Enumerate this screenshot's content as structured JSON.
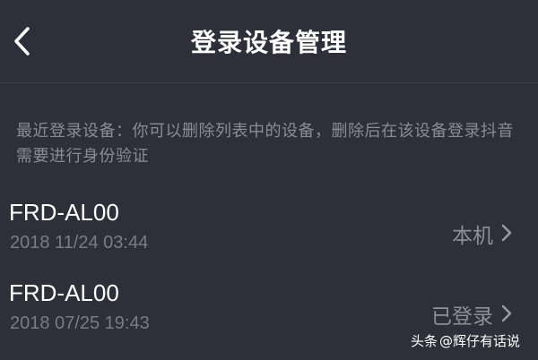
{
  "header": {
    "title": "登录设备管理",
    "back_icon": "chevron-left-icon"
  },
  "notice": "最近登录设备：你可以删除列表中的设备，删除后在该设备登录抖音需要进行身份验证",
  "devices": [
    {
      "name": "FRD-AL00",
      "time": "2018 11/24 03:44",
      "status": "本机"
    },
    {
      "name": "FRD-AL00",
      "time": "2018 07/25 19:43",
      "status": "已登录"
    }
  ],
  "watermark": {
    "prefix": "头条",
    "handle": "@辉仔有话说"
  }
}
